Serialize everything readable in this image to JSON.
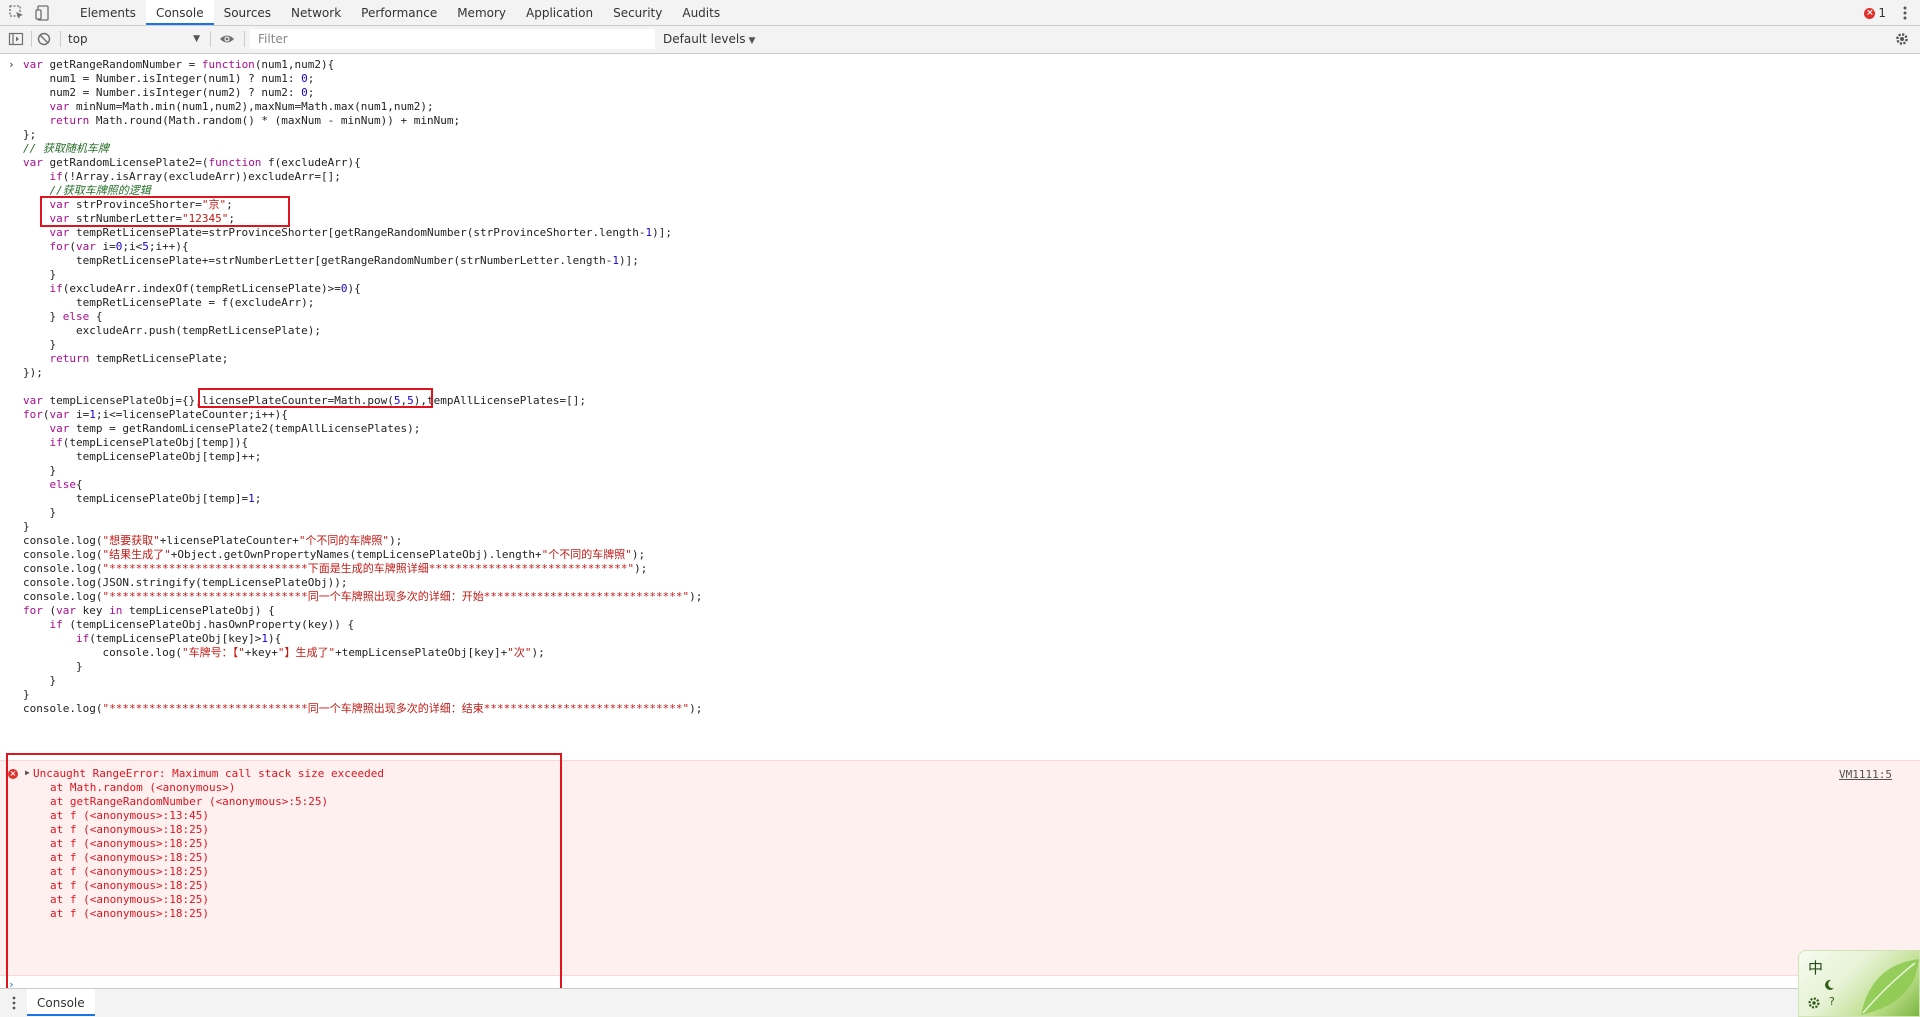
{
  "devtools": {
    "tabs": [
      "Elements",
      "Console",
      "Sources",
      "Network",
      "Performance",
      "Memory",
      "Application",
      "Security",
      "Audits"
    ],
    "active_tab": "Console",
    "error_count": "1"
  },
  "toolbar": {
    "context": "top",
    "filter_placeholder": "Filter",
    "levels": "Default levels"
  },
  "code_lines": [
    "var getRangeRandomNumber = function(num1,num2){",
    "    num1 = Number.isInteger(num1) ? num1: 0;",
    "    num2 = Number.isInteger(num2) ? num2: 0;",
    "    var minNum=Math.min(num1,num2),maxNum=Math.max(num1,num2);",
    "    return Math.round(Math.random() * (maxNum - minNum)) + minNum;",
    "};",
    "// 获取随机车牌",
    "var getRandomLicensePlate2=(function f(excludeArr){",
    "    if(!Array.isArray(excludeArr))excludeArr=[];",
    "    //获取车牌照的逻辑",
    "    var strProvinceShorter=\"京\";",
    "    var strNumberLetter=\"12345\";",
    "    var tempRetLicensePlate=strProvinceShorter[getRangeRandomNumber(strProvinceShorter.length-1)];",
    "    for(var i=0;i<5;i++){",
    "        tempRetLicensePlate+=strNumberLetter[getRangeRandomNumber(strNumberLetter.length-1)];",
    "    }",
    "    if(excludeArr.indexOf(tempRetLicensePlate)>=0){",
    "        tempRetLicensePlate = f(excludeArr);",
    "    } else {",
    "        excludeArr.push(tempRetLicensePlate);",
    "    }",
    "    return tempRetLicensePlate;",
    "});",
    "",
    "var tempLicensePlateObj={},licensePlateCounter=Math.pow(5,5),tempAllLicensePlates=[];",
    "for(var i=1;i<=licensePlateCounter;i++){",
    "    var temp = getRandomLicensePlate2(tempAllLicensePlates);",
    "    if(tempLicensePlateObj[temp]){",
    "        tempLicensePlateObj[temp]++;",
    "    }",
    "    else{",
    "        tempLicensePlateObj[temp]=1;",
    "    }",
    "}",
    "console.log(\"想要获取\"+licensePlateCounter+\"个不同的车牌照\");",
    "console.log(\"结果生成了\"+Object.getOwnPropertyNames(tempLicensePlateObj).length+\"个不同的车牌照\");",
    "console.log(\"******************************下面是生成的车牌照详细******************************\");",
    "console.log(JSON.stringify(tempLicensePlateObj));",
    "console.log(\"******************************同一个车牌照出现多次的详细：开始******************************\");",
    "for (var key in tempLicensePlateObj) {",
    "    if (tempLicensePlateObj.hasOwnProperty(key)) {",
    "        if(tempLicensePlateObj[key]>1){",
    "            console.log(\"车牌号：【\"+key+\"】生成了\"+tempLicensePlateObj[key]+\"次\");",
    "        }",
    "    }",
    "}",
    "console.log(\"******************************同一个车牌照出现多次的详细：结束******************************\");"
  ],
  "error": {
    "message": "Uncaught RangeError: Maximum call stack size exceeded",
    "source": "VM1111:5",
    "stack": [
      "at Math.random (<anonymous>)",
      "at getRangeRandomNumber (<anonymous>:5:25)",
      "at f (<anonymous>:13:45)",
      "at f (<anonymous>:18:25)",
      "at f (<anonymous>:18:25)",
      "at f (<anonymous>:18:25)",
      "at f (<anonymous>:18:25)",
      "at f (<anonymous>:18:25)",
      "at f (<anonymous>:18:25)",
      "at f (<anonymous>:18:25)"
    ]
  },
  "drawer": {
    "tab": "Console"
  },
  "ime": {
    "label": "中"
  },
  "icons": [
    "inspect-icon",
    "device-toggle-icon",
    "error-icon",
    "more-icon",
    "sidebar-toggle-icon",
    "clear-console-icon",
    "eye-icon",
    "settings-icon",
    "expand-triangle-icon"
  ],
  "colors": {
    "error": "#e0141e",
    "accent": "#1a73e8",
    "highlight_box": "#e0141e"
  }
}
